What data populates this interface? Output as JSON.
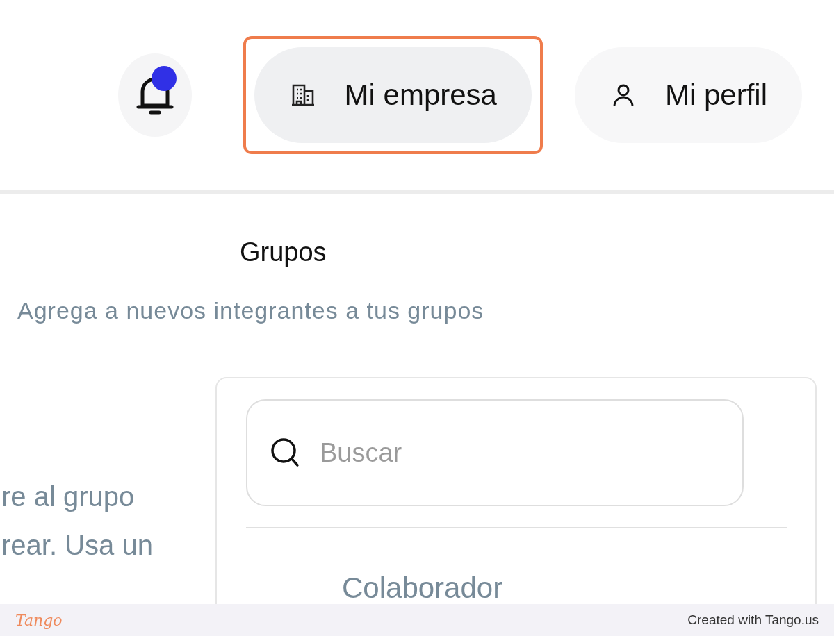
{
  "header": {
    "notifications": {
      "unread": true
    },
    "nav": [
      {
        "label": "Mi empresa",
        "kind": "building",
        "selected": true
      },
      {
        "label": "Mi perfil",
        "kind": "person",
        "selected": false
      }
    ]
  },
  "section": {
    "title": "Grupos",
    "subtitle": "Agrega a nuevos integrantes a tus grupos"
  },
  "left_text": [
    "re al grupo",
    "rear. Usa un"
  ],
  "search": {
    "placeholder": "Buscar"
  },
  "list_heading": "Colaborador",
  "footer": {
    "logo": "Tango",
    "credit": "Created with Tango.us"
  }
}
